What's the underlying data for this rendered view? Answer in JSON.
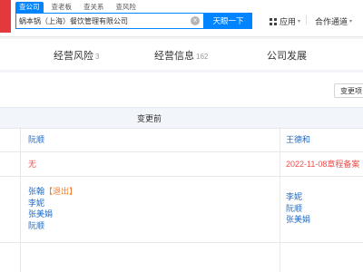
{
  "search": {
    "tabs": [
      "查公司",
      "查老板",
      "查关系",
      "查风险"
    ],
    "query": "蜗本锅（上海）餐饮管理有限公司",
    "clear_glyph": "×",
    "button": "天眼一下"
  },
  "header_menu": {
    "app_label": "应用",
    "channel_label": "合作通道",
    "caret": "▾"
  },
  "nav": [
    {
      "label": "经营风险",
      "count": "3"
    },
    {
      "label": "经营信息",
      "count": "162"
    },
    {
      "label": "公司发展",
      "count": ""
    }
  ],
  "change_button": "变更项",
  "table": {
    "before_header": "变更前",
    "rows": [
      {
        "before": [
          "阮顺"
        ],
        "after": [
          "王德和"
        ]
      },
      {
        "before": [
          "无"
        ],
        "after": [
          "2022-11-08章程备案"
        ]
      },
      {
        "before_tagged": {
          "name": "张翰",
          "tag": "【退出】"
        },
        "before": [
          "李妮",
          "张美娟",
          "阮顺"
        ],
        "after": [
          "李妮",
          "阮顺",
          "张美娟"
        ]
      }
    ]
  },
  "colors": {
    "brand_blue": "#0084ff",
    "link_blue": "#1a6bcc",
    "red": "#f04f4f",
    "orange": "#f57a2a",
    "logo_red": "#e4393c"
  }
}
